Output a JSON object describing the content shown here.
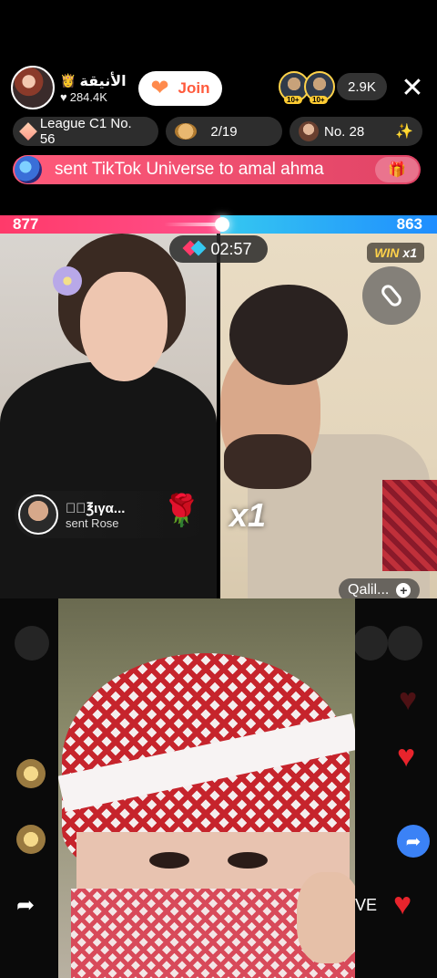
{
  "host": {
    "name": "الأنيقة",
    "likes": "284.4K",
    "join_label": "Join"
  },
  "viewers": {
    "levels": [
      "10+",
      "10+"
    ],
    "count": "2.9K"
  },
  "close_label": "✕",
  "pills": {
    "league": "League C1 No. 56",
    "rank": "2/19",
    "number": "No. 28"
  },
  "gift_banner": {
    "text": "sent TikTok Universe to amal ahma",
    "gift_icon": "gift-icon"
  },
  "battle": {
    "left_score": "877",
    "right_score": "863",
    "left_fraction": 0.504,
    "timer": "02:57",
    "win_label": "WIN",
    "win_count": "x1",
    "colors": {
      "left": "#ff3a6a",
      "right": "#35c8f0"
    }
  },
  "gift_toast": {
    "user": "◥ꦿ℥ιγα...",
    "action": "sent Rose",
    "combo": "x1"
  },
  "opponent_tag": "Qalil...",
  "bottom": {
    "live_fragment": "VE"
  },
  "icons": {
    "heart": "heart-icon",
    "share": "share-icon",
    "mic": "mic-icon",
    "rose": "rose-icon"
  }
}
